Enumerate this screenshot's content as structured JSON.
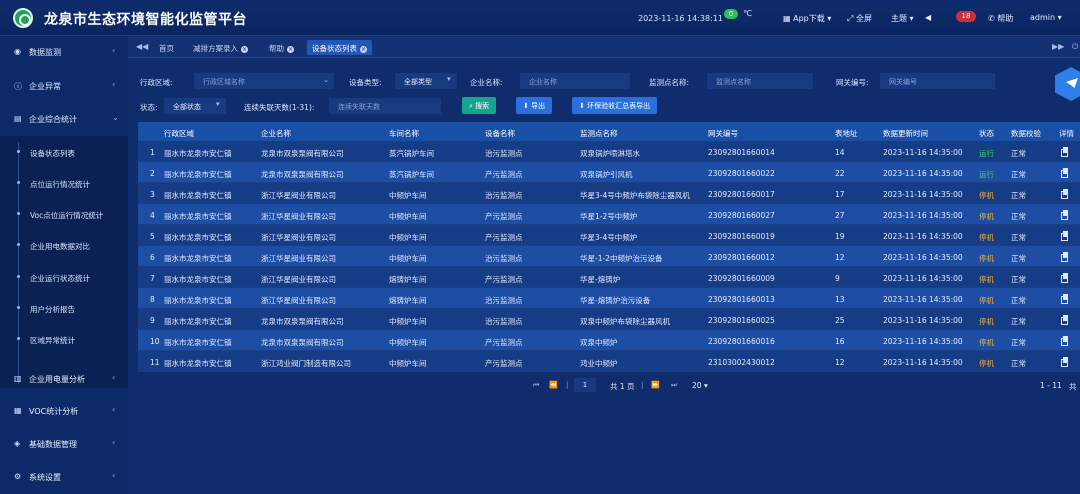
{
  "header": {
    "title": "龙泉市生态环境智能化监管平台",
    "datetime": "2023-11-16  14:38:11",
    "weather_badge": "0",
    "temp_unit": "℃",
    "app_download": "App下载",
    "fullscreen": "全屏",
    "theme": "主题",
    "alert_count": "18",
    "help": "帮助",
    "user": "admin"
  },
  "sidebar": {
    "items": [
      {
        "label": "数据监测",
        "icon": "gauge-icon"
      },
      {
        "label": "企业异常",
        "icon": "alert-circle-icon"
      },
      {
        "label": "企业综合统计",
        "icon": "book-icon"
      },
      {
        "label": "企业用电量分析",
        "icon": "bar-chart-icon"
      },
      {
        "label": "VOC统计分析",
        "icon": "calendar-grid-icon"
      },
      {
        "label": "基础数据管理",
        "icon": "layers-icon"
      },
      {
        "label": "系统设置",
        "icon": "gear-icon"
      }
    ],
    "submenu": [
      "设备状态列表",
      "点位运行情况统计",
      "Voc点位运行情况统计",
      "企业用电数据对比",
      "企业运行状态统计",
      "用户分析报告",
      "区域异常统计"
    ]
  },
  "tabs": [
    {
      "label": "首页",
      "closable": false
    },
    {
      "label": "减排方案录入",
      "closable": true
    },
    {
      "label": "帮助",
      "closable": true
    },
    {
      "label": "设备状态列表",
      "closable": true
    }
  ],
  "filters": {
    "region_label": "行政区域:",
    "region_placeholder": "行政区域名称",
    "device_type_label": "设备类型:",
    "device_type_value": "全部类型",
    "company_label": "企业名称:",
    "company_placeholder": "企业名称",
    "monitor_label": "监测点名称:",
    "monitor_placeholder": "监测点名称",
    "gateway_label": "网关编号:",
    "gateway_placeholder": "网关编号",
    "status_label": "状态:",
    "status_value": "全部状态",
    "days_label": "连续失联天数(1-31):",
    "days_placeholder": "连续失联天数",
    "search_btn": "搜索",
    "export_btn": "导出",
    "env_export_btn": "环保验收汇总表导出"
  },
  "table": {
    "columns": [
      "行政区域",
      "企业名称",
      "车间名称",
      "设备名称",
      "监测点名称",
      "网关编号",
      "表地址",
      "数据更新时间",
      "状态",
      "数据校验",
      "详情"
    ],
    "rows": [
      {
        "no": "1",
        "region": "丽水市龙泉市安仁镇",
        "company": "龙泉市双泉泵阀有限公司",
        "workshop": "蒸汽锅炉车间",
        "device": "治污监测点",
        "point": "双泉锅炉喷淋塔水",
        "gateway": "23092801660014",
        "addr": "14",
        "time": "2023-11-16 14:35:00",
        "status": "运行",
        "status_kind": "run",
        "check": "正常"
      },
      {
        "no": "2",
        "region": "丽水市龙泉市安仁镇",
        "company": "龙泉市双泉泵阀有限公司",
        "workshop": "蒸汽锅炉车间",
        "device": "产污监测点",
        "point": "双泉锅炉引风机",
        "gateway": "23092801660022",
        "addr": "22",
        "time": "2023-11-16 14:35:00",
        "status": "运行",
        "status_kind": "run",
        "check": "正常"
      },
      {
        "no": "3",
        "region": "丽水市龙泉市安仁镇",
        "company": "浙江华星阀业有限公司",
        "workshop": "中频炉车间",
        "device": "治污监测点",
        "point": "华星3-4号中频炉布袋除尘器风机",
        "gateway": "23092801660017",
        "addr": "17",
        "time": "2023-11-16 14:35:00",
        "status": "停机",
        "status_kind": "stop",
        "check": "正常"
      },
      {
        "no": "4",
        "region": "丽水市龙泉市安仁镇",
        "company": "浙江华星阀业有限公司",
        "workshop": "中频炉车间",
        "device": "产污监测点",
        "point": "华星1-2号中频炉",
        "gateway": "23092801660027",
        "addr": "27",
        "time": "2023-11-16 14:35:00",
        "status": "停机",
        "status_kind": "stop",
        "check": "正常"
      },
      {
        "no": "5",
        "region": "丽水市龙泉市安仁镇",
        "company": "浙江华星阀业有限公司",
        "workshop": "中频炉车间",
        "device": "产污监测点",
        "point": "华星3-4号中频炉",
        "gateway": "23092801660019",
        "addr": "19",
        "time": "2023-11-16 14:35:00",
        "status": "停机",
        "status_kind": "stop",
        "check": "正常"
      },
      {
        "no": "6",
        "region": "丽水市龙泉市安仁镇",
        "company": "浙江华星阀业有限公司",
        "workshop": "中频炉车间",
        "device": "治污监测点",
        "point": "华星-1-2中频炉治污设备",
        "gateway": "23092801660012",
        "addr": "12",
        "time": "2023-11-16 14:35:00",
        "status": "停机",
        "status_kind": "stop",
        "check": "正常"
      },
      {
        "no": "7",
        "region": "丽水市龙泉市安仁镇",
        "company": "浙江华星阀业有限公司",
        "workshop": "熔铸炉车间",
        "device": "产污监测点",
        "point": "华星-熔铸炉",
        "gateway": "23092801660009",
        "addr": "9",
        "time": "2023-11-16 14:35:00",
        "status": "停机",
        "status_kind": "stop",
        "check": "正常"
      },
      {
        "no": "8",
        "region": "丽水市龙泉市安仁镇",
        "company": "浙江华星阀业有限公司",
        "workshop": "熔铸炉车间",
        "device": "治污监测点",
        "point": "华星-熔铸炉治污设备",
        "gateway": "23092801660013",
        "addr": "13",
        "time": "2023-11-16 14:35:00",
        "status": "停机",
        "status_kind": "stop",
        "check": "正常"
      },
      {
        "no": "9",
        "region": "丽水市龙泉市安仁镇",
        "company": "龙泉市双泉泵阀有限公司",
        "workshop": "中频炉车间",
        "device": "治污监测点",
        "point": "双泉中频炉布袋除尘器风机",
        "gateway": "23092801660025",
        "addr": "25",
        "time": "2023-11-16 14:35:00",
        "status": "停机",
        "status_kind": "stop",
        "check": "正常"
      },
      {
        "no": "10",
        "region": "丽水市龙泉市安仁镇",
        "company": "龙泉市双泉泵阀有限公司",
        "workshop": "中频炉车间",
        "device": "产污监测点",
        "point": "双泉中频炉",
        "gateway": "23092801660016",
        "addr": "16",
        "time": "2023-11-16 14:35:00",
        "status": "停机",
        "status_kind": "stop",
        "check": "正常"
      },
      {
        "no": "11",
        "region": "丽水市龙泉市安仁镇",
        "company": "浙江鸿业阀门制造有限公司",
        "workshop": "中频炉车间",
        "device": "产污监测点",
        "point": "鸿业中频炉",
        "gateway": "23103002430012",
        "addr": "12",
        "time": "2023-11-16 14:35:00",
        "status": "停机",
        "status_kind": "stop",
        "check": "正常"
      }
    ]
  },
  "pager": {
    "page": "1",
    "total_pages": "共 1 页",
    "page_size": "20",
    "range": "1 - 11",
    "total_prefix": "共"
  },
  "colors": {
    "running": "#39d66a",
    "stopped": "#f2b02e",
    "accent": "#2a6fe0"
  }
}
